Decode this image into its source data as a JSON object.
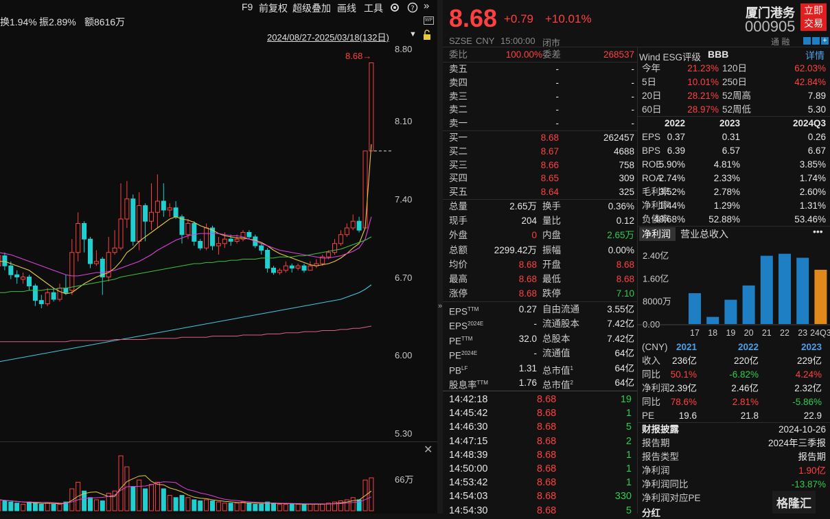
{
  "toolbar": {
    "f9": "F9",
    "fq": "前复权",
    "overlay": "超级叠加",
    "draw": "画线",
    "tools": "工具"
  },
  "info": {
    "turnover": "换1.94%",
    "amplitude": "振2.89%",
    "amount": "额8616万",
    "range": "2024/08/27-2025/03/18(132日)"
  },
  "yaxis": [
    "8.80",
    "8.10",
    "7.40",
    "6.70",
    "6.00",
    "5.30"
  ],
  "last_marker": "8.68",
  "vol_label": "66万",
  "colors": {
    "up": "#ff4040",
    "down": "#20d0d0",
    "ma5": "#e6e6e6",
    "ma10": "#e8c840",
    "ma20": "#e040e0",
    "ma60": "#40c040",
    "ma120": "#40c8e0",
    "ma250": "#e06080"
  },
  "candles": [
    {
      "o": 6.86,
      "c": 6.95,
      "h": 7.02,
      "l": 6.84
    },
    {
      "o": 6.95,
      "c": 6.86,
      "h": 6.98,
      "l": 6.82
    },
    {
      "o": 6.86,
      "c": 6.78,
      "h": 6.9,
      "l": 6.74
    },
    {
      "o": 6.78,
      "c": 6.76,
      "h": 6.82,
      "l": 6.7
    },
    {
      "o": 6.74,
      "c": 6.76,
      "h": 6.8,
      "l": 6.7
    },
    {
      "o": 6.76,
      "c": 6.68,
      "h": 6.78,
      "l": 6.64
    },
    {
      "o": 6.68,
      "c": 6.55,
      "h": 6.7,
      "l": 6.5
    },
    {
      "o": 6.55,
      "c": 6.52,
      "h": 6.6,
      "l": 6.48
    },
    {
      "o": 6.52,
      "c": 6.62,
      "h": 6.66,
      "l": 6.5
    },
    {
      "o": 6.62,
      "c": 6.56,
      "h": 6.66,
      "l": 6.54
    },
    {
      "o": 6.56,
      "c": 6.66,
      "h": 6.7,
      "l": 6.54
    },
    {
      "o": 6.66,
      "c": 6.62,
      "h": 6.78,
      "l": 6.6
    },
    {
      "o": 6.64,
      "c": 6.98,
      "h": 7.1,
      "l": 6.6
    },
    {
      "o": 6.98,
      "c": 7.24,
      "h": 7.34,
      "l": 6.9
    },
    {
      "o": 7.24,
      "c": 7.1,
      "h": 7.26,
      "l": 6.98
    },
    {
      "o": 7.1,
      "c": 6.88,
      "h": 7.12,
      "l": 6.84
    },
    {
      "o": 6.88,
      "c": 6.9,
      "h": 7.0,
      "l": 6.86
    },
    {
      "o": 6.92,
      "c": 6.76,
      "h": 6.94,
      "l": 6.6
    },
    {
      "o": 6.76,
      "c": 6.98,
      "h": 7.12,
      "l": 6.72
    },
    {
      "o": 6.98,
      "c": 7.02,
      "h": 7.18,
      "l": 6.96
    },
    {
      "o": 7.02,
      "c": 7.28,
      "h": 7.6,
      "l": 7.0
    },
    {
      "o": 7.28,
      "c": 7.46,
      "h": 7.62,
      "l": 7.2
    },
    {
      "o": 7.46,
      "c": 7.08,
      "h": 7.5,
      "l": 7.04
    },
    {
      "o": 7.08,
      "c": 7.4,
      "h": 7.52,
      "l": 7.0
    },
    {
      "o": 7.4,
      "c": 7.26,
      "h": 7.42,
      "l": 7.08
    },
    {
      "o": 7.26,
      "c": 7.34,
      "h": 7.6,
      "l": 7.18
    },
    {
      "o": 7.34,
      "c": 7.44,
      "h": 7.68,
      "l": 7.2
    },
    {
      "o": 7.44,
      "c": 7.36,
      "h": 7.6,
      "l": 7.3
    },
    {
      "o": 7.36,
      "c": 7.38,
      "h": 7.42,
      "l": 7.3
    },
    {
      "o": 7.38,
      "c": 7.3,
      "h": 7.44,
      "l": 7.28
    },
    {
      "o": 7.3,
      "c": 7.14,
      "h": 7.32,
      "l": 7.06
    },
    {
      "o": 7.14,
      "c": 7.24,
      "h": 7.28,
      "l": 7.1
    },
    {
      "o": 7.24,
      "c": 7.08,
      "h": 7.26,
      "l": 7.04
    },
    {
      "o": 7.08,
      "c": 7.02,
      "h": 7.1,
      "l": 7.0
    },
    {
      "o": 7.02,
      "c": 7.2,
      "h": 7.24,
      "l": 7.0
    },
    {
      "o": 7.2,
      "c": 7.04,
      "h": 7.22,
      "l": 7.0
    },
    {
      "o": 7.04,
      "c": 7.06,
      "h": 7.12,
      "l": 6.96
    },
    {
      "o": 7.06,
      "c": 7.1,
      "h": 7.16,
      "l": 7.02
    },
    {
      "o": 7.1,
      "c": 7.08,
      "h": 7.14,
      "l": 7.04
    },
    {
      "o": 7.08,
      "c": 7.1,
      "h": 7.14,
      "l": 7.06
    },
    {
      "o": 7.1,
      "c": 7.16,
      "h": 7.18,
      "l": 7.08
    },
    {
      "o": 7.16,
      "c": 7.12,
      "h": 7.18,
      "l": 7.1
    },
    {
      "o": 7.12,
      "c": 7.04,
      "h": 7.14,
      "l": 7.02
    },
    {
      "o": 7.04,
      "c": 7.0,
      "h": 7.06,
      "l": 6.96
    },
    {
      "o": 7.0,
      "c": 6.84,
      "h": 7.02,
      "l": 6.8
    },
    {
      "o": 6.84,
      "c": 6.8,
      "h": 6.86,
      "l": 6.78
    },
    {
      "o": 6.8,
      "c": 6.82,
      "h": 6.84,
      "l": 6.78
    },
    {
      "o": 6.82,
      "c": 6.86,
      "h": 6.9,
      "l": 6.8
    },
    {
      "o": 6.86,
      "c": 6.84,
      "h": 6.88,
      "l": 6.8
    },
    {
      "o": 6.84,
      "c": 6.86,
      "h": 6.88,
      "l": 6.82
    },
    {
      "o": 6.86,
      "c": 6.82,
      "h": 6.88,
      "l": 6.8
    },
    {
      "o": 6.82,
      "c": 6.86,
      "h": 6.9,
      "l": 6.82
    },
    {
      "o": 6.86,
      "c": 6.88,
      "h": 6.92,
      "l": 6.84
    },
    {
      "o": 6.88,
      "c": 6.94,
      "h": 6.96,
      "l": 6.86
    },
    {
      "o": 6.94,
      "c": 6.98,
      "h": 7.0,
      "l": 6.92
    },
    {
      "o": 6.98,
      "c": 7.06,
      "h": 7.1,
      "l": 6.96
    },
    {
      "o": 7.06,
      "c": 7.14,
      "h": 7.18,
      "l": 7.04
    },
    {
      "o": 7.14,
      "c": 7.2,
      "h": 7.24,
      "l": 7.12
    },
    {
      "o": 7.2,
      "c": 7.26,
      "h": 7.32,
      "l": 7.18
    },
    {
      "o": 7.26,
      "c": 7.18,
      "h": 7.3,
      "l": 7.16
    },
    {
      "o": 7.2,
      "c": 7.89,
      "h": 7.89,
      "l": 7.2
    },
    {
      "o": 7.89,
      "c": 8.68,
      "h": 8.68,
      "l": 7.89
    }
  ],
  "ma_series": {
    "ma10": [
      6.9,
      6.9,
      6.88,
      6.86,
      6.84,
      6.82,
      6.78,
      6.74,
      6.7,
      6.66,
      6.63,
      6.61,
      6.62,
      6.66,
      6.7,
      6.73,
      6.76,
      6.78,
      6.8,
      6.84,
      6.9,
      6.98,
      7.02,
      7.08,
      7.12,
      7.16,
      7.2,
      7.24,
      7.28,
      7.3,
      7.28,
      7.27,
      7.25,
      7.22,
      7.2,
      7.18,
      7.15,
      7.13,
      7.12,
      7.11,
      7.11,
      7.1,
      7.09,
      7.07,
      7.04,
      7.0,
      6.97,
      6.95,
      6.93,
      6.91,
      6.89,
      6.87,
      6.86,
      6.87,
      6.88,
      6.9,
      6.93,
      6.97,
      7.02,
      7.06,
      7.2,
      7.95
    ],
    "ma20": [
      6.98,
      6.97,
      6.96,
      6.94,
      6.92,
      6.9,
      6.88,
      6.86,
      6.84,
      6.82,
      6.8,
      6.78,
      6.77,
      6.77,
      6.78,
      6.79,
      6.8,
      6.8,
      6.81,
      6.82,
      6.84,
      6.86,
      6.88,
      6.9,
      6.93,
      6.96,
      7.0,
      7.03,
      7.06,
      7.09,
      7.11,
      7.13,
      7.14,
      7.15,
      7.15,
      7.15,
      7.15,
      7.14,
      7.13,
      7.13,
      7.12,
      7.1,
      7.08,
      7.06,
      7.04,
      7.02,
      7.0,
      6.99,
      6.98,
      6.97,
      6.96,
      6.95,
      6.94,
      6.93,
      6.93,
      6.94,
      6.95,
      6.97,
      6.99,
      7.02,
      7.1,
      7.3
    ],
    "ma60": [
      6.62,
      6.62,
      6.63,
      6.63,
      6.63,
      6.64,
      6.64,
      6.64,
      6.65,
      6.65,
      6.66,
      6.66,
      6.67,
      6.68,
      6.69,
      6.7,
      6.71,
      6.72,
      6.73,
      6.74,
      6.76,
      6.77,
      6.78,
      6.79,
      6.8,
      6.81,
      6.82,
      6.83,
      6.84,
      6.85,
      6.86,
      6.87,
      6.88,
      6.88,
      6.89,
      6.89,
      6.9,
      6.9,
      6.91,
      6.91,
      6.92,
      6.92,
      6.92,
      6.93,
      6.93,
      6.93,
      6.94,
      6.94,
      6.94,
      6.95,
      6.95,
      6.96,
      6.97,
      6.98,
      6.99,
      7.0,
      7.01,
      7.03,
      7.05,
      7.07,
      7.09,
      7.12
    ],
    "ma120": [
      6.0,
      6.01,
      6.02,
      6.03,
      6.04,
      6.05,
      6.06,
      6.07,
      6.08,
      6.09,
      6.1,
      6.11,
      6.12,
      6.13,
      6.14,
      6.15,
      6.16,
      6.17,
      6.18,
      6.19,
      6.2,
      6.21,
      6.22,
      6.23,
      6.24,
      6.25,
      6.26,
      6.27,
      6.28,
      6.29,
      6.3,
      6.31,
      6.32,
      6.33,
      6.34,
      6.35,
      6.36,
      6.37,
      6.38,
      6.39,
      6.4,
      6.41,
      6.42,
      6.43,
      6.44,
      6.45,
      6.46,
      6.47,
      6.48,
      6.49,
      6.5,
      6.51,
      6.52,
      6.53,
      6.54,
      6.55,
      6.56,
      6.58,
      6.6,
      6.62,
      6.65,
      6.69
    ],
    "ma250": [
      6.18,
      6.18,
      6.18,
      6.18,
      6.18,
      6.18,
      6.18,
      6.18,
      6.18,
      6.18,
      6.18,
      6.18,
      6.19,
      6.19,
      6.19,
      6.19,
      6.19,
      6.19,
      6.19,
      6.2,
      6.2,
      6.2,
      6.2,
      6.2,
      6.2,
      6.21,
      6.21,
      6.21,
      6.21,
      6.21,
      6.22,
      6.22,
      6.22,
      6.22,
      6.22,
      6.23,
      6.23,
      6.23,
      6.23,
      6.23,
      6.24,
      6.24,
      6.24,
      6.24,
      6.25,
      6.25,
      6.25,
      6.26,
      6.26,
      6.26,
      6.27,
      6.27,
      6.27,
      6.28,
      6.28,
      6.28,
      6.29,
      6.29,
      6.3,
      6.3,
      6.31,
      6.32
    ]
  },
  "volumes": [
    10,
    9,
    8,
    7,
    6,
    8,
    7,
    6,
    7,
    6,
    6,
    8,
    20,
    26,
    18,
    12,
    10,
    9,
    16,
    18,
    50,
    40,
    22,
    28,
    20,
    24,
    26,
    20,
    14,
    12,
    14,
    12,
    10,
    9,
    10,
    9,
    8,
    7,
    7,
    7,
    8,
    7,
    6,
    6,
    8,
    7,
    6,
    6,
    6,
    6,
    6,
    6,
    6,
    6,
    7,
    8,
    9,
    10,
    12,
    10,
    28,
    30
  ],
  "quote": {
    "price": "8.68",
    "change": "+0.79",
    "pct": "+10.01%",
    "name": "厦门港务",
    "code": "000905",
    "trade_btn": "立即交易",
    "market": "SZSE",
    "currency": "CNY",
    "time": "15:00:00",
    "status": "闭市",
    "flags": "通 融"
  },
  "order": {
    "wb_label": "委比",
    "wb": "100.00%",
    "wc_label": "委差",
    "wc": "268537"
  },
  "asks": [
    {
      "l": "卖五",
      "p": "-",
      "v": "-"
    },
    {
      "l": "卖四",
      "p": "-",
      "v": "-"
    },
    {
      "l": "卖三",
      "p": "-",
      "v": "-"
    },
    {
      "l": "卖二",
      "p": "-",
      "v": "-"
    },
    {
      "l": "卖一",
      "p": "-",
      "v": "-"
    }
  ],
  "bids": [
    {
      "l": "买一",
      "p": "8.68",
      "v": "262457"
    },
    {
      "l": "买二",
      "p": "8.67",
      "v": "4688"
    },
    {
      "l": "买三",
      "p": "8.66",
      "v": "758"
    },
    {
      "l": "买四",
      "p": "8.65",
      "v": "309"
    },
    {
      "l": "买五",
      "p": "8.64",
      "v": "325"
    }
  ],
  "stats": [
    {
      "l1": "总量",
      "v1": "2.65万",
      "l2": "换手",
      "v2": "0.36%",
      "c1": "white",
      "c2": "white"
    },
    {
      "l1": "现手",
      "v1": "204",
      "l2": "量比",
      "v2": "0.12",
      "c1": "white",
      "c2": "white"
    },
    {
      "l1": "外盘",
      "v1": "0",
      "l2": "内盘",
      "v2": "2.65万",
      "c1": "red",
      "c2": "green"
    },
    {
      "l1": "总额",
      "v1": "2299.42万",
      "l2": "振幅",
      "v2": "0.00%",
      "c1": "white",
      "c2": "white"
    },
    {
      "l1": "均价",
      "v1": "8.68",
      "l2": "开盘",
      "v2": "8.68",
      "c1": "red",
      "c2": "red"
    },
    {
      "l1": "最高",
      "v1": "8.68",
      "l2": "最低",
      "v2": "8.68",
      "c1": "red",
      "c2": "red"
    },
    {
      "l1": "涨停",
      "v1": "8.68",
      "l2": "跌停",
      "v2": "7.10",
      "c1": "red",
      "c2": "green"
    }
  ],
  "fundamentals": [
    {
      "l1": "EPS",
      "s1": "TTM",
      "v1": "0.27",
      "l2": "自由流通",
      "s2": "",
      "v2": "3.55亿"
    },
    {
      "l1": "EPS",
      "s1": "2024E",
      "v1": "-",
      "l2": "流通股本",
      "s2": "",
      "v2": "7.42亿"
    },
    {
      "l1": "PE",
      "s1": "TTM",
      "v1": "32.0",
      "l2": "总股本",
      "s2": "",
      "v2": "7.42亿"
    },
    {
      "l1": "PE",
      "s1": "2024E",
      "v1": "-",
      "l2": "流通值",
      "s2": "",
      "v2": "64亿"
    },
    {
      "l1": "PB",
      "s1": "LF",
      "v1": "1.31",
      "l2": "总市值",
      "s2": "1",
      "v2": "64亿"
    },
    {
      "l1": "股息率",
      "s1": "TTM",
      "v1": "1.76",
      "l2": "总市值",
      "s2": "2",
      "v2": "64亿"
    }
  ],
  "ticks": [
    {
      "t": "14:42:18",
      "p": "8.68",
      "v": "19",
      "c": "green"
    },
    {
      "t": "14:45:42",
      "p": "8.68",
      "v": "1",
      "c": "green"
    },
    {
      "t": "14:46:30",
      "p": "8.68",
      "v": "5",
      "c": "green"
    },
    {
      "t": "14:47:15",
      "p": "8.68",
      "v": "2",
      "c": "green"
    },
    {
      "t": "14:48:39",
      "p": "8.68",
      "v": "1",
      "c": "green"
    },
    {
      "t": "14:50:00",
      "p": "8.68",
      "v": "1",
      "c": "green"
    },
    {
      "t": "14:53:42",
      "p": "8.68",
      "v": "1",
      "c": "green"
    },
    {
      "t": "14:54:03",
      "p": "8.68",
      "v": "330",
      "c": "green"
    },
    {
      "t": "14:54:30",
      "p": "8.68",
      "v": "5",
      "c": "green"
    }
  ],
  "esg": {
    "label": "Wind ESG评级",
    "rating": "BBB",
    "detail": "详情"
  },
  "returns": [
    {
      "l1": "今年",
      "v1": "21.23%",
      "l2": "120日",
      "v2": "62.03%",
      "c2": "red"
    },
    {
      "l1": "5日",
      "v1": "10.01%",
      "l2": "250日",
      "v2": "42.84%",
      "c2": "red"
    },
    {
      "l1": "20日",
      "v1": "28.21%",
      "l2": "52周高",
      "v2": "7.89",
      "c2": "white"
    },
    {
      "l1": "60日",
      "v1": "28.97%",
      "l2": "52周低",
      "v2": "5.30",
      "c2": "white"
    }
  ],
  "fin_headers": [
    "2022",
    "2023",
    "2024Q3"
  ],
  "fin_rows": [
    {
      "l": "EPS",
      "v": [
        "0.37",
        "0.31",
        "0.26"
      ]
    },
    {
      "l": "BPS",
      "v": [
        "6.39",
        "6.57",
        "6.67"
      ]
    },
    {
      "l": "ROE",
      "v": [
        "5.90%",
        "4.81%",
        "3.85%"
      ]
    },
    {
      "l": "ROA",
      "v": [
        "2.74%",
        "2.33%",
        "1.74%"
      ]
    },
    {
      "l": "毛利率",
      "v": [
        "3.52%",
        "2.78%",
        "2.60%"
      ]
    },
    {
      "l": "净利率",
      "v": [
        "1.44%",
        "1.29%",
        "1.31%"
      ]
    },
    {
      "l": "负债率",
      "v": [
        "48.68%",
        "52.88%",
        "53.46%"
      ]
    }
  ],
  "bar_tabs": [
    "净利润",
    "营业总收入"
  ],
  "chart_data": {
    "type": "bar",
    "categories": [
      "17",
      "18",
      "19",
      "20",
      "21",
      "22",
      "23",
      "24Q3"
    ],
    "values": [
      1.08,
      0.25,
      0.85,
      1.35,
      2.39,
      2.46,
      2.32,
      1.9
    ],
    "unit": "亿",
    "ylabels": [
      "2.40亿",
      "1.60亿",
      "8000万",
      "0.00"
    ],
    "ylim": [
      0,
      2.5
    ],
    "colors": {
      "bar": "#1f7fc4",
      "last": "#e08a1e"
    }
  },
  "rev_headers": [
    "(CNY)",
    "2021",
    "2022",
    "2023"
  ],
  "rev_rows": [
    {
      "l": "收入",
      "v": [
        "236亿",
        "220亿",
        "229亿"
      ],
      "c": [
        "white",
        "white",
        "white"
      ]
    },
    {
      "l": "同比",
      "v": [
        "50.1%",
        "-6.82%",
        "4.24%"
      ],
      "c": [
        "red",
        "green",
        "red"
      ]
    },
    {
      "l": "净利润",
      "v": [
        "2.39亿",
        "2.46亿",
        "2.32亿"
      ],
      "c": [
        "white",
        "white",
        "white"
      ]
    },
    {
      "l": "同比",
      "v": [
        "78.6%",
        "2.81%",
        "-5.86%"
      ],
      "c": [
        "red",
        "red",
        "green"
      ]
    },
    {
      "l": "PE",
      "v": [
        "19.6",
        "21.8",
        "22.9"
      ],
      "c": [
        "white",
        "white",
        "white"
      ]
    }
  ],
  "disclosure": {
    "title": "财报披露",
    "date": "2024-10-26",
    "rows": [
      {
        "l": "报告期",
        "v": "2024年三季报",
        "c": "white"
      },
      {
        "l": "报告类型",
        "v": "报告期",
        "c": "white"
      },
      {
        "l": "净利润",
        "v": "1.90亿",
        "c": "red"
      },
      {
        "l": "净利润同比",
        "v": "-13.87%",
        "c": "green"
      },
      {
        "l": "净利润对应PE",
        "v": "",
        "c": "white"
      }
    ]
  },
  "dividend": "分红",
  "watermark": "格隆汇"
}
